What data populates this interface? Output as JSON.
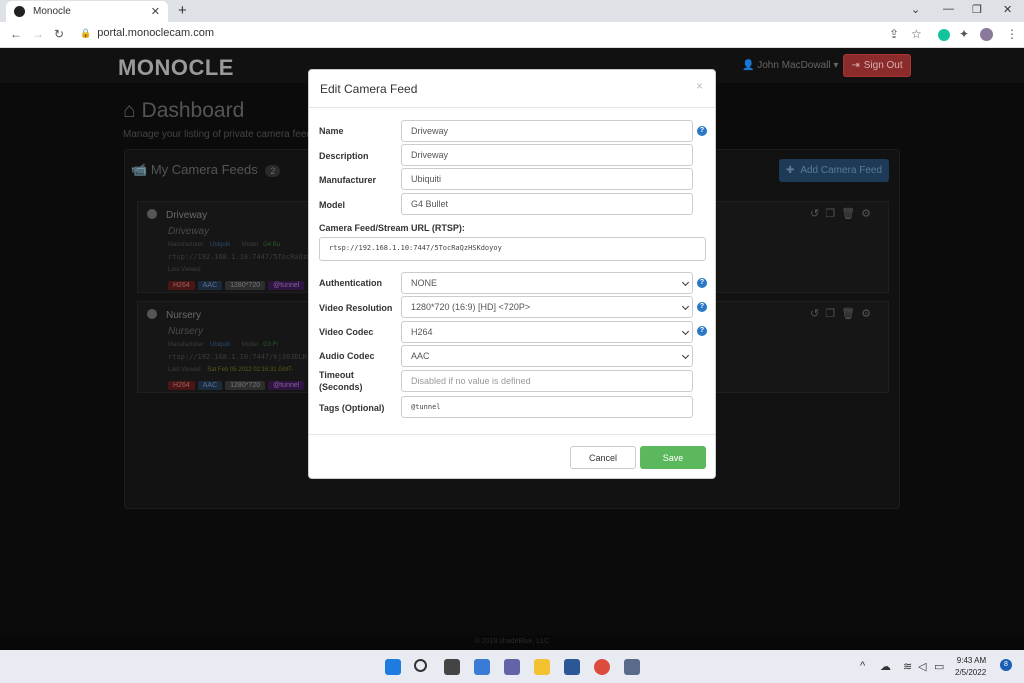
{
  "browser": {
    "tab_title": "Monocle",
    "tab_close": "✕",
    "new_tab": "+",
    "url": "portal.monoclecam.com",
    "window_controls": [
      "⌄",
      "—",
      "❐",
      "✕"
    ]
  },
  "app": {
    "logo": "MONOCLE",
    "user": "John MacDowall",
    "signout": "Sign Out"
  },
  "dashboard": {
    "title": "Dashboard",
    "subtitle": "Manage your listing of private camera feeds",
    "panel_title": "My Camera Feeds",
    "feed_count": "2",
    "add_button": "Add Camera Feed",
    "feeds": [
      {
        "name": "Driveway",
        "description": "Driveway",
        "manufacturer_label": "Manufacturer",
        "manufacturer": "Ubiquiti",
        "model_label": "Model",
        "model": "G4 Bu",
        "url": "rtsp://192.168.1.10:7447/5TocRaQzH",
        "last_viewed_label": "Last Viewed",
        "last_viewed": "",
        "badges": [
          "H264",
          "AAC",
          "1280*720",
          "@tunnel"
        ]
      },
      {
        "name": "Nursery",
        "description": "Nursery",
        "manufacturer_label": "Manufacturer",
        "manufacturer": "Ubiquiti",
        "model_label": "Model",
        "model": "G3 Fl",
        "url": "rtsp://192.168.1.10:7447/Kj303DLK",
        "last_viewed_label": "Last Viewed",
        "last_viewed": "Sat Feb 05 2022 02:16:31 GMT-",
        "badges": [
          "H264",
          "AAC",
          "1280*720",
          "@tunnel"
        ]
      }
    ]
  },
  "modal": {
    "title": "Edit Camera Feed",
    "close": "×",
    "fields": {
      "name_label": "Name",
      "name": "Driveway",
      "description_label": "Description",
      "description": "Driveway",
      "manufacturer_label": "Manufacturer",
      "manufacturer": "Ubiquiti",
      "model_label": "Model",
      "model": "G4 Bullet",
      "rtsp_label": "Camera Feed/Stream URL (RTSP):",
      "rtsp": "rtsp://192.168.1.10:7447/5TocRaQzHSKdoyoy",
      "auth_label": "Authentication",
      "auth": "NONE",
      "resolution_label": "Video Resolution",
      "resolution": "1280*720 (16:9) [HD] <720P>",
      "vcodec_label": "Video Codec",
      "vcodec": "H264",
      "acodec_label": "Audio Codec",
      "acodec": "AAC",
      "timeout_label_1": "Timeout",
      "timeout_label_2": "(Seconds)",
      "timeout_placeholder": "Disabled if no value is defined",
      "tags_label": "Tags (Optional)",
      "tags": "@tunnel"
    },
    "help": "?",
    "cancel": "Cancel",
    "save": "Save"
  },
  "footer": "© 2018 shadeBlue, LLC",
  "taskbar": {
    "time": "9:43 AM",
    "date": "2/5/2022",
    "notifications": "8"
  }
}
